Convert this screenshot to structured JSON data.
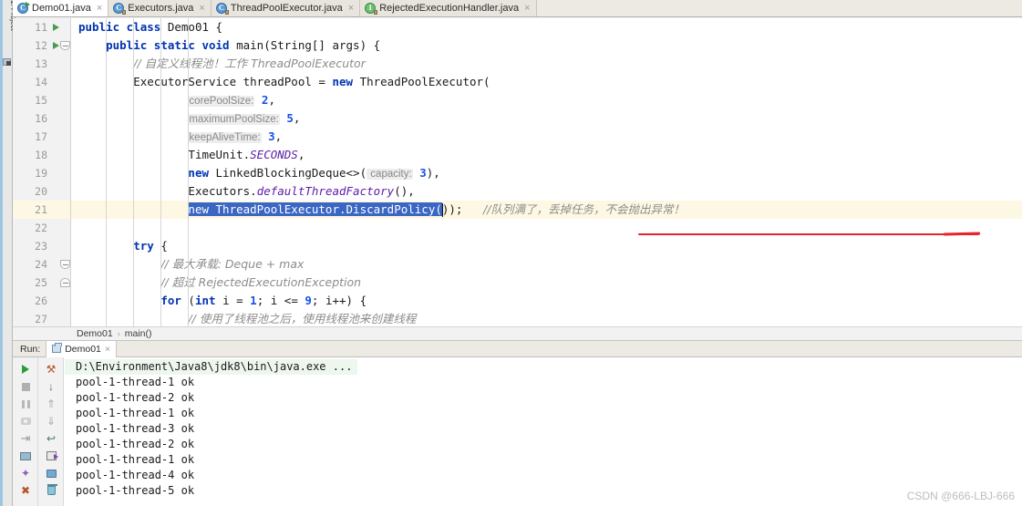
{
  "window": {
    "side_tool_label": "1: Project",
    "watermark": "CSDN @666-LBJ-666"
  },
  "tabs": [
    {
      "label": "Demo01.java",
      "icon": "java-class-runnable-icon",
      "icon_letter": "C",
      "active": true,
      "close_glyph": "×"
    },
    {
      "label": "Executors.java",
      "icon": "java-class-readonly-icon",
      "icon_letter": "C",
      "active": false,
      "close_glyph": "×"
    },
    {
      "label": "ThreadPoolExecutor.java",
      "icon": "java-class-readonly-icon",
      "icon_letter": "C",
      "active": false,
      "close_glyph": "×"
    },
    {
      "label": "RejectedExecutionHandler.java",
      "icon": "java-interface-readonly-icon",
      "icon_letter": "I",
      "active": false,
      "close_glyph": "×"
    }
  ],
  "editor": {
    "first_line_number": 11,
    "caret_line_number": 21,
    "lines": [
      {
        "n": "11",
        "gutter": "run-arrow",
        "indent": 0,
        "segments": [
          {
            "t": "public class ",
            "c": "kw"
          },
          {
            "t": "Demo01 {",
            "c": "plain"
          }
        ]
      },
      {
        "n": "12",
        "gutter": "run-arrow-fold",
        "indent": 1,
        "segments": [
          {
            "t": "public static void ",
            "c": "kw"
          },
          {
            "t": "main(String[] args) {",
            "c": "plain"
          }
        ]
      },
      {
        "n": "13",
        "gutter": "",
        "indent": 2,
        "segments": [
          {
            "t": "// 自定义线程池！工作 ThreadPoolExecutor",
            "c": "cmt-zh"
          }
        ]
      },
      {
        "n": "14",
        "gutter": "",
        "indent": 2,
        "segments": [
          {
            "t": "ExecutorService threadPool = ",
            "c": "plain"
          },
          {
            "t": "new ",
            "c": "kw"
          },
          {
            "t": "ThreadPoolExecutor(",
            "c": "plain"
          }
        ]
      },
      {
        "n": "15",
        "gutter": "",
        "indent": 4,
        "segments": [
          {
            "t": "corePoolSize:",
            "c": "hint"
          },
          {
            "t": " ",
            "c": "plain"
          },
          {
            "t": "2",
            "c": "num"
          },
          {
            "t": ",",
            "c": "plain"
          }
        ]
      },
      {
        "n": "16",
        "gutter": "",
        "indent": 4,
        "segments": [
          {
            "t": "maximumPoolSize:",
            "c": "hint"
          },
          {
            "t": " ",
            "c": "plain"
          },
          {
            "t": "5",
            "c": "num"
          },
          {
            "t": ",",
            "c": "plain"
          }
        ]
      },
      {
        "n": "17",
        "gutter": "",
        "indent": 4,
        "segments": [
          {
            "t": "keepAliveTime:",
            "c": "hint"
          },
          {
            "t": " ",
            "c": "plain"
          },
          {
            "t": "3",
            "c": "num"
          },
          {
            "t": ",",
            "c": "plain"
          }
        ]
      },
      {
        "n": "18",
        "gutter": "",
        "indent": 4,
        "segments": [
          {
            "t": "TimeUnit.",
            "c": "plain"
          },
          {
            "t": "SECONDS",
            "c": "stat"
          },
          {
            "t": ",",
            "c": "plain"
          }
        ]
      },
      {
        "n": "19",
        "gutter": "",
        "indent": 4,
        "segments": [
          {
            "t": "new ",
            "c": "kw"
          },
          {
            "t": "LinkedBlockingDeque<>(",
            "c": "plain"
          },
          {
            "t": " capacity:",
            "c": "hint"
          },
          {
            "t": " ",
            "c": "plain"
          },
          {
            "t": "3",
            "c": "num"
          },
          {
            "t": "),",
            "c": "plain"
          }
        ]
      },
      {
        "n": "20",
        "gutter": "",
        "indent": 4,
        "segments": [
          {
            "t": "Executors.",
            "c": "plain"
          },
          {
            "t": "defaultThreadFactory",
            "c": "stat"
          },
          {
            "t": "(),",
            "c": "plain"
          }
        ]
      },
      {
        "n": "21",
        "gutter": "",
        "indent": 4,
        "caret": true,
        "segments": [
          {
            "t": "new ThreadPoolExecutor.DiscardPolicy(",
            "c": "sel"
          },
          {
            "t": "));",
            "c": "plain"
          },
          {
            "t": "   ",
            "c": "plain"
          },
          {
            "t": "//队列满了，丢掉任务，不会抛出异常！",
            "c": "cmt-zh"
          }
        ]
      },
      {
        "n": "22",
        "gutter": "",
        "indent": 2,
        "segments": []
      },
      {
        "n": "23",
        "gutter": "",
        "indent": 2,
        "segments": [
          {
            "t": "try ",
            "c": "kw"
          },
          {
            "t": "{",
            "c": "plain"
          }
        ]
      },
      {
        "n": "24",
        "gutter": "fold",
        "indent": 3,
        "segments": [
          {
            "t": "// 最大承载: Deque + max",
            "c": "cmt-zh"
          }
        ]
      },
      {
        "n": "25",
        "gutter": "fold-up",
        "indent": 3,
        "segments": [
          {
            "t": "// 超过 RejectedExecutionException",
            "c": "cmt-zh"
          }
        ]
      },
      {
        "n": "26",
        "gutter": "",
        "indent": 3,
        "segments": [
          {
            "t": "for ",
            "c": "kw"
          },
          {
            "t": "(",
            "c": "plain"
          },
          {
            "t": "int ",
            "c": "kw"
          },
          {
            "t": "i = ",
            "c": "plain"
          },
          {
            "t": "1",
            "c": "num"
          },
          {
            "t": "; i <= ",
            "c": "plain"
          },
          {
            "t": "9",
            "c": "num"
          },
          {
            "t": "; i++) {",
            "c": "plain"
          }
        ]
      },
      {
        "n": "27",
        "gutter": "",
        "indent": 4,
        "segments": [
          {
            "t": "// 使用了线程池之后，使用线程池来创建线程",
            "c": "cmt-zh"
          }
        ]
      }
    ],
    "annotation": {
      "type": "red-underline",
      "color": "#e8242a"
    }
  },
  "breadcrumb": {
    "items": [
      "Demo01",
      "main()"
    ],
    "separator": "›"
  },
  "run_window": {
    "label": "Run:",
    "tab_label": "Demo01",
    "tab_close_glyph": "×",
    "left_tools": [
      {
        "name": "rerun-button",
        "glyph_class": "g-play"
      },
      {
        "name": "stop-button",
        "glyph_class": "g-stop"
      },
      {
        "name": "pause-button",
        "glyph_class": "g-pause"
      },
      {
        "name": "screenshot-button",
        "glyph_class": "g-cam"
      },
      {
        "name": "step-into-button",
        "glyph_class": "g-exit",
        "glyph": "⇥"
      },
      {
        "name": "show-monitor-button",
        "glyph_class": "g-mon"
      },
      {
        "name": "pin-tab-button",
        "glyph_class": "g-pin",
        "glyph": "✦"
      },
      {
        "name": "close-button",
        "glyph_class": "g-x",
        "glyph": "✖"
      }
    ],
    "right_tools": [
      {
        "name": "rerun-failed-icon",
        "glyph_class": "g-hammer",
        "glyph": "⚒"
      },
      {
        "name": "sort-output-icon",
        "glyph_class": "g-sortdown",
        "glyph": "↓"
      },
      {
        "name": "scroll-up-icon",
        "glyph_class": "g-up",
        "glyph": "⇑"
      },
      {
        "name": "scroll-down-icon",
        "glyph_class": "g-down",
        "glyph": "⇓"
      },
      {
        "name": "soft-wrap-icon",
        "glyph_class": "g-wrap",
        "glyph": "↩"
      },
      {
        "name": "save-output-icon",
        "glyph_class": "g-save"
      },
      {
        "name": "print-icon",
        "glyph_class": "g-print"
      },
      {
        "name": "clear-all-icon",
        "glyph_class": "g-trash"
      }
    ],
    "console_lines": [
      {
        "text": "D:\\Environment\\Java8\\jdk8\\bin\\java.exe ...",
        "command": true
      },
      {
        "text": "pool-1-thread-1 ok",
        "command": false
      },
      {
        "text": "pool-1-thread-2 ok",
        "command": false
      },
      {
        "text": "pool-1-thread-1 ok",
        "command": false
      },
      {
        "text": "pool-1-thread-3 ok",
        "command": false
      },
      {
        "text": "pool-1-thread-2 ok",
        "command": false
      },
      {
        "text": "pool-1-thread-1 ok",
        "command": false
      },
      {
        "text": "pool-1-thread-4 ok",
        "command": false
      },
      {
        "text": "pool-1-thread-5 ok",
        "command": false
      }
    ]
  },
  "colors": {
    "keyword": "#0033b3",
    "number": "#1750eb",
    "comment": "#8c8c8c",
    "static": "#5a1ba9",
    "selection": "#3a66c4",
    "caret_line": "#fdf8e3",
    "annotation_red": "#e8242a",
    "console_command_bg": "#eef7ee"
  }
}
